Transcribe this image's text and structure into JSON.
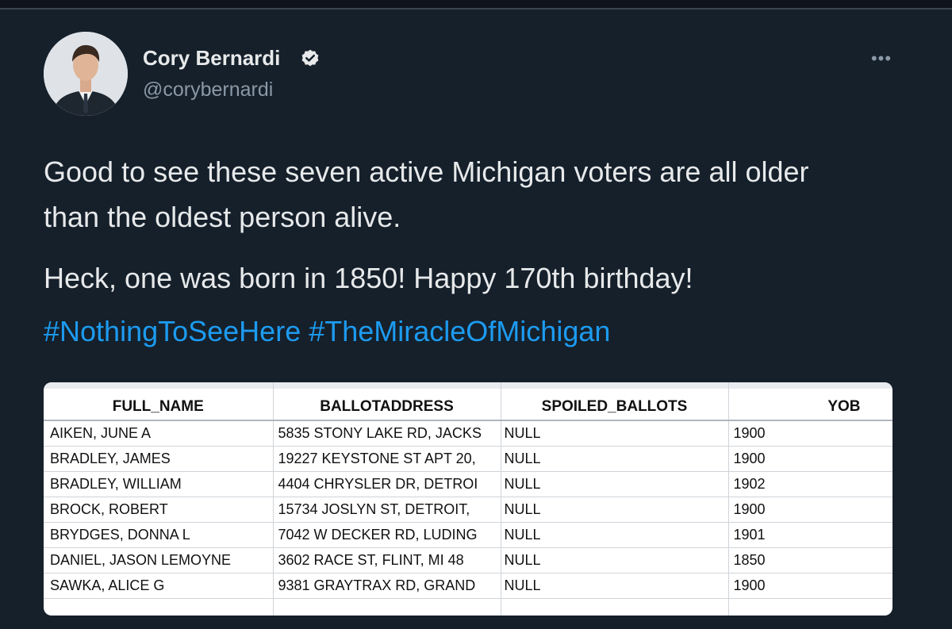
{
  "tweet": {
    "display_name": "Cory Bernardi",
    "handle": "@corybernardi",
    "verified_icon": "verified-badge-icon",
    "more_label": "•••",
    "text_line1": "Good to see these seven active Michigan voters are all older",
    "text_line2": "than the oldest person alive.",
    "text_line3": "Heck, one was born in 1850! Happy 170th birthday!",
    "hashtags": [
      "#NothingToSeeHere",
      "#TheMiracleOfMichigan"
    ],
    "colors": {
      "background": "#15202b",
      "text": "#e7e9ea",
      "muted": "#8b98a5",
      "link": "#1d9bf0"
    }
  },
  "table": {
    "headers": [
      "FULL_NAME",
      "BALLOTADDRESS",
      "SPOILED_BALLOTS",
      "YOB"
    ],
    "rows": [
      [
        "AIKEN, JUNE A",
        "5835 STONY LAKE RD, JACKS",
        "NULL",
        "1900"
      ],
      [
        "BRADLEY, JAMES",
        "19227 KEYSTONE ST APT 20,",
        "NULL",
        "1900"
      ],
      [
        "BRADLEY, WILLIAM",
        "4404 CHRYSLER DR, DETROI",
        "NULL",
        "1902"
      ],
      [
        "BROCK, ROBERT",
        "15734 JOSLYN ST, DETROIT,",
        "NULL",
        "1900"
      ],
      [
        "BRYDGES, DONNA L",
        "7042 W DECKER RD, LUDING",
        "NULL",
        "1901"
      ],
      [
        "DANIEL, JASON LEMOYNE",
        "3602 RACE ST, FLINT, MI 48",
        "NULL",
        "1850"
      ],
      [
        "SAWKA, ALICE G",
        "9381 GRAYTRAX RD, GRAND",
        "NULL",
        "1900"
      ]
    ]
  }
}
